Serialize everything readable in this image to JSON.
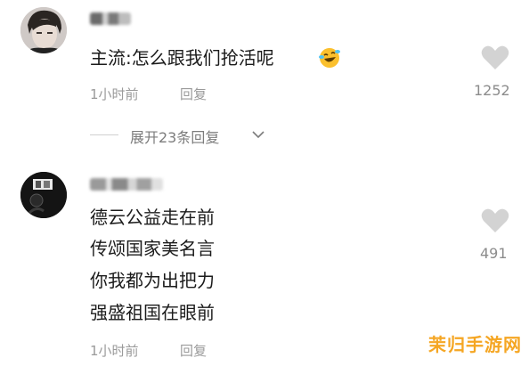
{
  "comments": [
    {
      "text_lines": [
        "主流:怎么跟我们抢活呢"
      ],
      "time": "1小时前",
      "reply_label": "回复",
      "likes": "1252",
      "expand_label": "展开23条回复"
    },
    {
      "text_lines": [
        "德云公益走在前",
        "传颂国家美名言",
        "你我都为出把力",
        "强盛祖国在眼前"
      ],
      "time": "1小时前",
      "reply_label": "回复",
      "likes": "491"
    }
  ],
  "watermark": "茉归手游网",
  "icons": {
    "like": "heart-icon",
    "expand": "chevron-down-icon",
    "emoji": "laughing-crying-emoji-icon"
  },
  "colors": {
    "text": "#1b1b1b",
    "meta": "#9a9a9a",
    "heart": "#d3d3d3",
    "watermark": "#f5a623"
  }
}
